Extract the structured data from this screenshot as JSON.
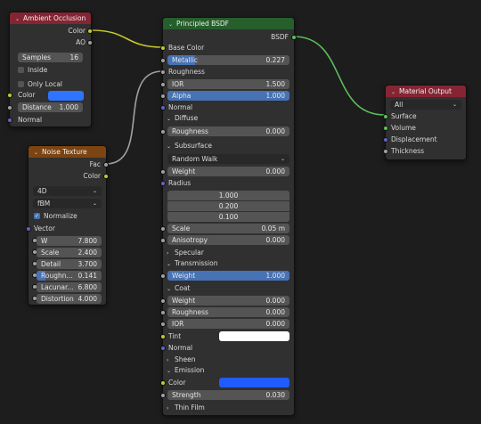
{
  "colors": {
    "wire_yellow": "#c7c729",
    "wire_gray": "#a1a1a1",
    "wire_green": "#5cbd5c",
    "base_color_blue": "#2f74ff",
    "emission_blue": "#1f5bff",
    "tint_white": "#ffffff",
    "accent": "#4772b3"
  },
  "ao": {
    "title": "Ambient Occlusion",
    "out_color": "Color",
    "out_ao": "AO",
    "samples_label": "Samples",
    "samples_value": "16",
    "inside_label": "Inside",
    "only_local_label": "Only Local",
    "in_color": "Color",
    "distance_label": "Distance",
    "distance_value": "1.000",
    "in_normal": "Normal"
  },
  "noise": {
    "title": "Noise Texture",
    "out_fac": "Fac",
    "out_color": "Color",
    "dimensions": "4D",
    "type": "fBM",
    "normalize_label": "Normalize",
    "vector_label": "Vector",
    "fields": [
      {
        "label": "W",
        "value": "7.800"
      },
      {
        "label": "Scale",
        "value": "2.400"
      },
      {
        "label": "Detail",
        "value": "3.700"
      },
      {
        "label": "Roughn...",
        "value": "0.141",
        "fill": 0.141
      },
      {
        "label": "Lacunar...",
        "value": "6.800"
      },
      {
        "label": "Distortion",
        "value": "4.000"
      }
    ]
  },
  "bsdf": {
    "title": "Principled BSDF",
    "out_bsdf": "BSDF",
    "base_color": "Base Color",
    "metallic_label": "Metallic",
    "metallic_value": "0.227",
    "metallic_fill": 0.227,
    "roughness_label": "Roughness",
    "ior_label": "IOR",
    "ior_value": "1.500",
    "alpha_label": "Alpha",
    "alpha_value": "1.000",
    "normal_label": "Normal",
    "diffuse_label": "Diffuse",
    "diffuse_roughness_label": "Roughness",
    "diffuse_roughness_value": "0.000",
    "subsurface_label": "Subsurface",
    "subsurface_method": "Random Walk",
    "ss_weight_label": "Weight",
    "ss_weight_value": "0.000",
    "radius_label": "Radius",
    "radius_values": [
      "1.000",
      "0.200",
      "0.100"
    ],
    "ss_scale_label": "Scale",
    "ss_scale_value": "0.05 m",
    "anisotropy_label": "Anisotropy",
    "anisotropy_value": "0.000",
    "specular_label": "Specular",
    "transmission_label": "Transmission",
    "tr_weight_label": "Weight",
    "tr_weight_value": "1.000",
    "coat_label": "Coat",
    "coat_weight_label": "Weight",
    "coat_weight_value": "0.000",
    "coat_roughness_label": "Roughness",
    "coat_roughness_value": "0.000",
    "coat_ior_label": "IOR",
    "coat_ior_value": "0.000",
    "tint_label": "Tint",
    "coat_normal_label": "Normal",
    "sheen_label": "Sheen",
    "emission_label": "Emission",
    "emission_color_label": "Color",
    "strength_label": "Strength",
    "strength_value": "0.030",
    "thin_film_label": "Thin Film"
  },
  "output": {
    "title": "Material Output",
    "target": "All",
    "surface": "Surface",
    "volume": "Volume",
    "displacement": "Displacement",
    "thickness": "Thickness"
  }
}
